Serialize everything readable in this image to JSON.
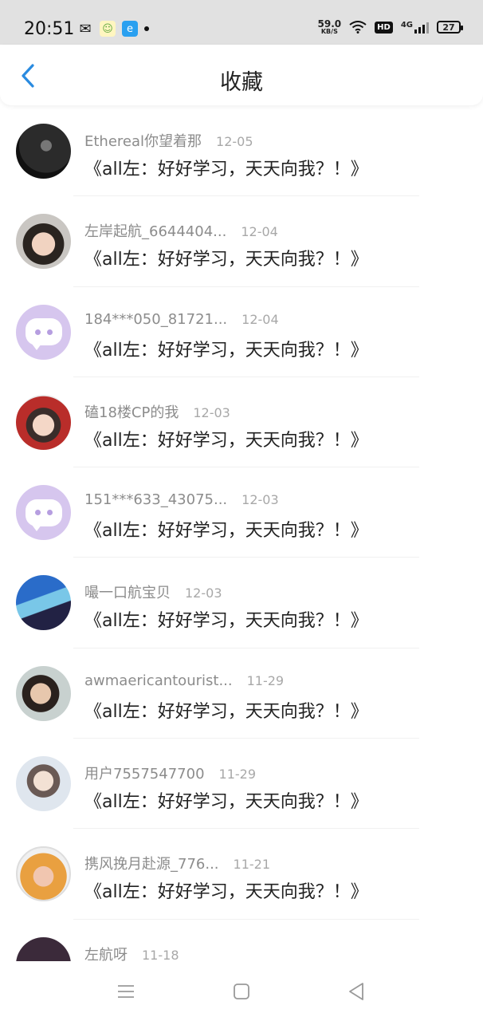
{
  "status_bar": {
    "time": "20:51",
    "net_speed_value": "59.0",
    "net_speed_unit": "KB/S",
    "hd": "HD",
    "network": "4G",
    "battery": "27"
  },
  "header": {
    "title": "收藏"
  },
  "colors": {
    "accent": "#2a8be0",
    "default_avatar": "#d6c6ee"
  },
  "items": [
    {
      "username": "Ethereal你望着那",
      "date": "12-05",
      "title": "《all左：好好学习，天天向我？！》"
    },
    {
      "username": "左岸起航_6644404...",
      "date": "12-04",
      "title": "《all左：好好学习，天天向我？！》"
    },
    {
      "username": "184***050_81721...",
      "date": "12-04",
      "title": "《all左：好好学习，天天向我？！》"
    },
    {
      "username": "磕18楼CP的我",
      "date": "12-03",
      "title": "《all左：好好学习，天天向我？！》"
    },
    {
      "username": "151***633_43075...",
      "date": "12-03",
      "title": "《all左：好好学习，天天向我？！》"
    },
    {
      "username": "嘬一口航宝贝",
      "date": "12-03",
      "title": "《all左：好好学习，天天向我？！》"
    },
    {
      "username": "awmaericantourist...",
      "date": "11-29",
      "title": "《all左：好好学习，天天向我？！》"
    },
    {
      "username": "用户7557547700",
      "date": "11-29",
      "title": "《all左：好好学习，天天向我？！》"
    },
    {
      "username": "携风挽月赴源_776...",
      "date": "11-21",
      "title": "《all左：好好学习，天天向我？！》"
    },
    {
      "username": "左航呀",
      "date": "11-18",
      "title": ""
    }
  ]
}
